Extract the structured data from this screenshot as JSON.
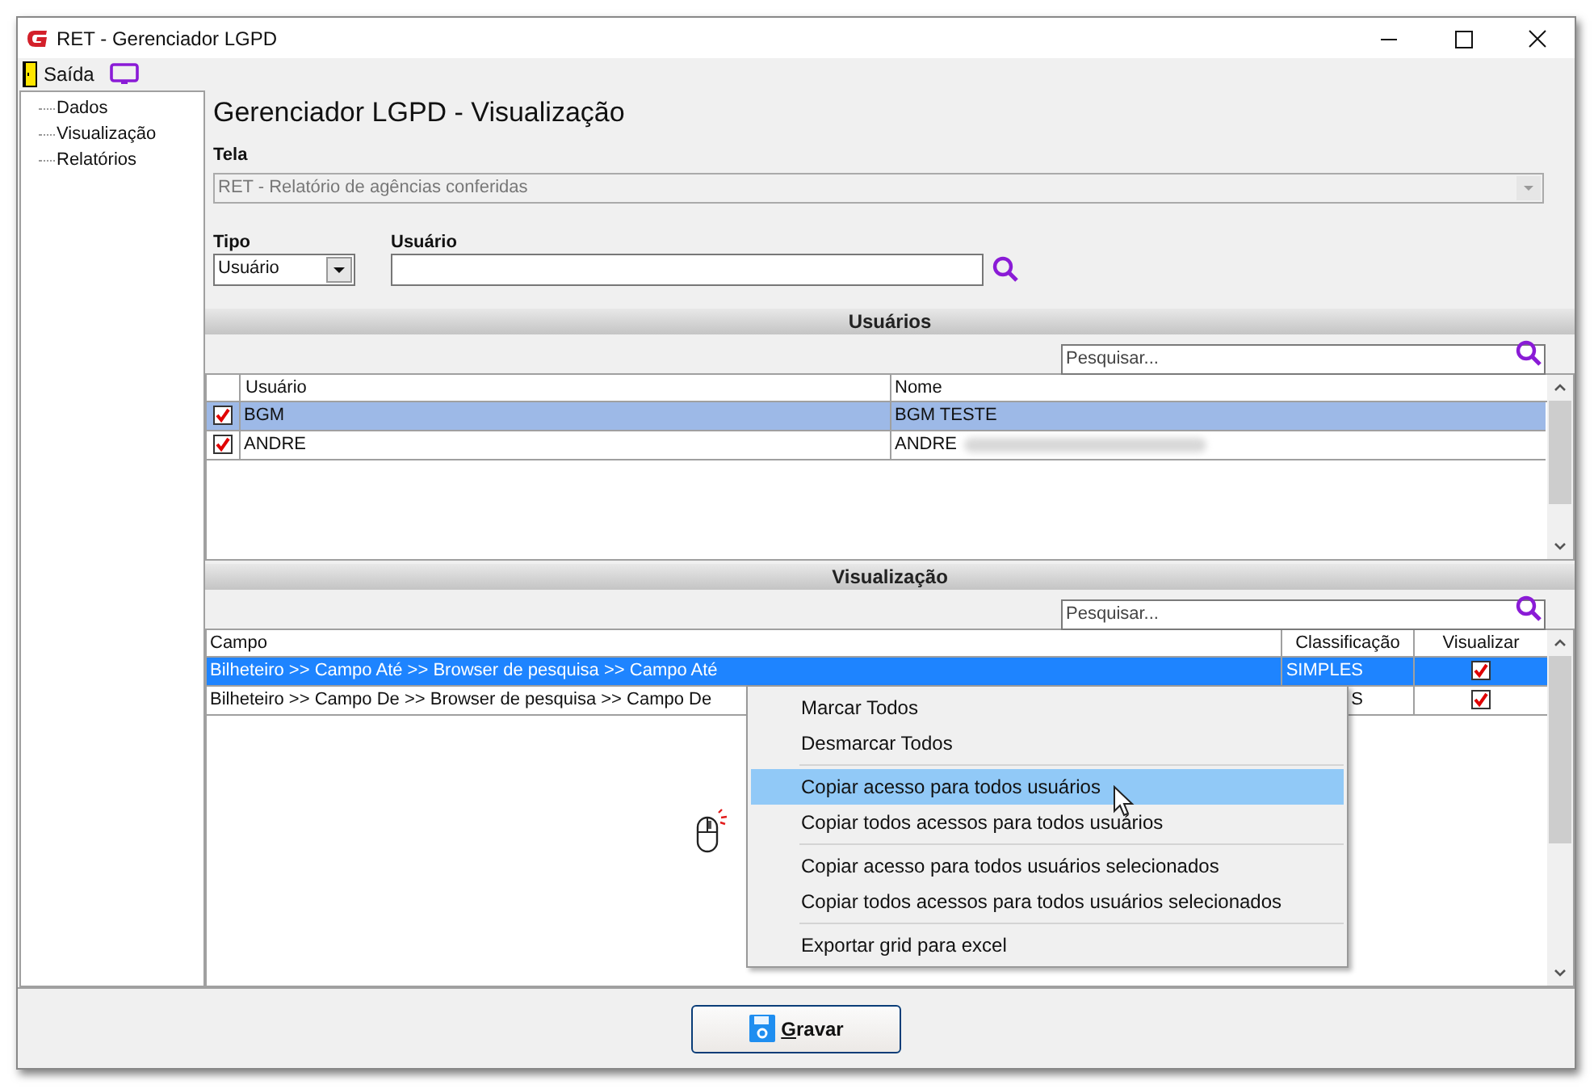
{
  "window": {
    "title": "RET - Gerenciador LGPD"
  },
  "toolbar": {
    "exit_label": "Saída"
  },
  "sidebar": {
    "items": [
      {
        "label": "Dados"
      },
      {
        "label": "Visualização"
      },
      {
        "label": "Relatórios"
      }
    ]
  },
  "heading": "Gerenciador LGPD - Visualização",
  "tela": {
    "label": "Tela",
    "value": "RET - Relatório de agências conferidas",
    "disabled": true
  },
  "tipo": {
    "label": "Tipo",
    "value": "Usuário"
  },
  "usuario": {
    "label": "Usuário"
  },
  "users_section": {
    "title": "Usuários",
    "search": {
      "placeholder": "Pesquisar..."
    },
    "columns": [
      "Usuário",
      "Nome"
    ],
    "rows": [
      {
        "checked": true,
        "selected": true,
        "usuario": "BGM",
        "nome": "BGM TESTE",
        "redacted": false
      },
      {
        "checked": true,
        "selected": false,
        "usuario": "ANDRE",
        "nome": "ANDRE",
        "redacted": true
      }
    ]
  },
  "view_section": {
    "title": "Visualização",
    "search": {
      "placeholder": "Pesquisar..."
    },
    "columns": [
      "Campo",
      "Classificação",
      "Visualizar"
    ],
    "rows": [
      {
        "selected": true,
        "campo": "Bilheteiro >> Campo Até >> Browser de pesquisa >> Campo Até",
        "classificacao": "SIMPLES",
        "visualizar": true
      },
      {
        "selected": false,
        "campo": "Bilheteiro >> Campo De >> Browser de pesquisa >> Campo De",
        "classificacao": "S",
        "visualizar": true
      }
    ]
  },
  "context_menu": {
    "groups": [
      [
        {
          "label": "Marcar Todos",
          "selected": false
        },
        {
          "label": "Desmarcar Todos",
          "selected": false
        }
      ],
      [
        {
          "label": "Copiar acesso para todos usuários",
          "selected": true
        },
        {
          "label": "Copiar todos acessos para todos usuários",
          "selected": false
        }
      ],
      [
        {
          "label": "Copiar acesso para todos usuários selecionados",
          "selected": false
        },
        {
          "label": "Copiar todos acessos para todos usuários selecionados",
          "selected": false
        }
      ],
      [
        {
          "label": "Exportar grid para excel",
          "selected": false
        }
      ]
    ]
  },
  "save_button": {
    "label": "Gravar"
  }
}
